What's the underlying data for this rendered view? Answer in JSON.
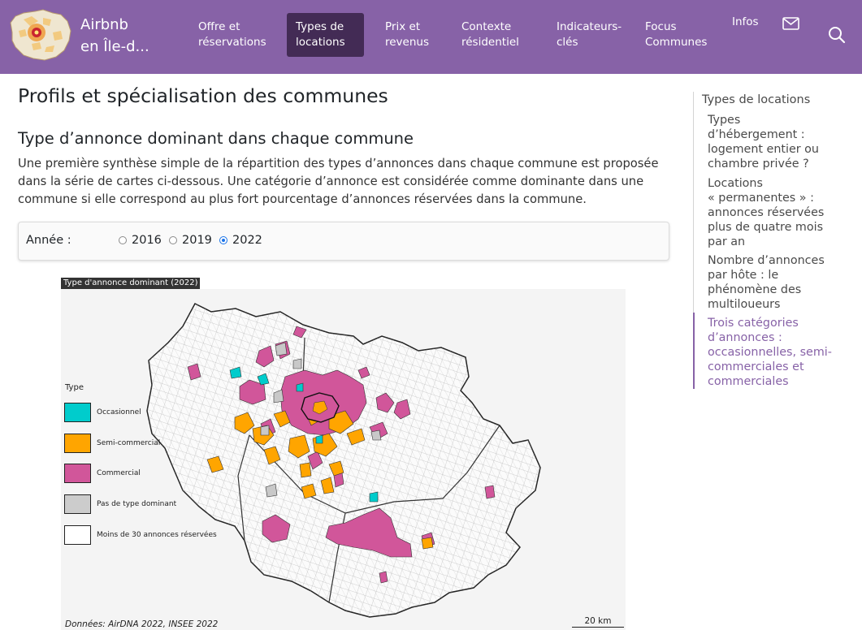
{
  "nav": {
    "brand": "Airbnb en Île-d...",
    "brand_line1": "Airbnb",
    "brand_line2": "en Île-d...",
    "items": [
      {
        "label": "Offre et réservations",
        "l1": "Offre et",
        "l2": "réservations"
      },
      {
        "label": "Types de locations",
        "l1": "Types de",
        "l2": "locations"
      },
      {
        "label": "Prix et revenus",
        "l1": "Prix et",
        "l2": "revenus"
      },
      {
        "label": "Contexte résidentiel",
        "l1": "Contexte",
        "l2": "résidentiel"
      },
      {
        "label": "Indicateurs-clés",
        "l1": "Indicateurs-",
        "l2": "clés"
      },
      {
        "label": "Focus Communes",
        "l1": "Focus",
        "l2": "Communes"
      },
      {
        "label": "Infos",
        "l1": "Infos",
        "l2": ""
      }
    ],
    "icons": [
      "mail-icon",
      "search-icon"
    ],
    "bg_color": "#8762a7",
    "active_color": "#432b55"
  },
  "main": {
    "title": "Profils et spécialisation des communes",
    "subtitle": "Type d’annonce dominant dans chaque commune",
    "paragraph": "Une première synthèse simple de la répartition des types d’annonces dans chaque commune est proposée dans la série de cartes ci-dessous. Une catégorie d’annonce est considérée comme dominante dans une commune si elle correspond au plus fort pourcentage d’annonces réservées dans la commune.",
    "filter": {
      "label": "Année :",
      "options": [
        "2016",
        "2019",
        "2022"
      ],
      "selected": "2022"
    }
  },
  "map": {
    "title": "Type d'annonce dominant (2022)",
    "legend_title": "Type",
    "legend": [
      {
        "label": "Occasionnel",
        "color": "#00cccc"
      },
      {
        "label": "Semi-commercial",
        "color": "#ffa500"
      },
      {
        "label": "Commercial",
        "color": "#d1569a"
      },
      {
        "label": "Pas de type dominant",
        "color": "#cccccc"
      },
      {
        "label": "Moins de 30 annonces réservées",
        "color": "#ffffff"
      }
    ],
    "source": "Données: AirDNA 2022, INSEE 2022",
    "scale": "20 km"
  },
  "toc": {
    "heading": "Types de locations",
    "items": [
      {
        "text": "Types d’hébergement : logement entier ou chambre privée ?",
        "lines": [
          "Types",
          "d’hébergement :",
          "logement entier ou",
          "chambre privée ?"
        ]
      },
      {
        "text": "Locations « permanentes » : annonces réservées plus de quatre mois par an",
        "lines": [
          "Locations",
          "« permanentes » :",
          "annonces réservées",
          "plus de quatre mois",
          "par an"
        ]
      },
      {
        "text": "Nombre d’annonces par hôte : le phénomène des multiloueurs",
        "lines": [
          "Nombre d’annonces",
          "par hôte : le",
          "phénomène des",
          "multiloueurs"
        ]
      },
      {
        "text": "Trois catégories d’annonces : occasionnelles, semi-commerciales et commerciales",
        "lines": [
          "Trois catégories",
          "d’annonces :",
          "occasionnelles, semi-",
          "commerciales et",
          "commerciales"
        ]
      }
    ],
    "active_index": 3,
    "accent_color": "#8762a7"
  }
}
